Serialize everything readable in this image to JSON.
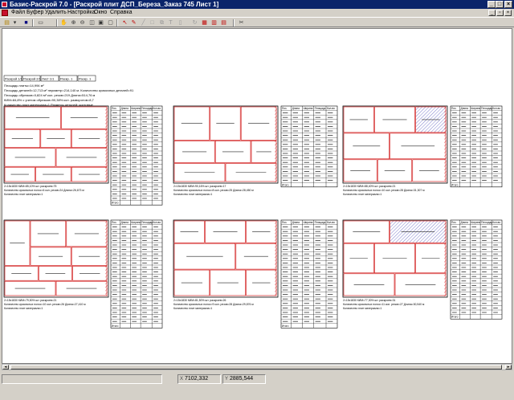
{
  "window": {
    "title": "Базис-Раскрой 7.0 - [Раскрой плит ДСП_Береза_Заказ 745 Лист 1]",
    "minimize": "_",
    "maximize": "□",
    "close": "×"
  },
  "menu": {
    "items": [
      "Файл",
      "Буфер",
      "Удалить",
      "Настройка",
      "Окно",
      "Справка"
    ],
    "mdi_minimize": "_",
    "mdi_restore": "▫",
    "mdi_close": "×"
  },
  "toolbar": {
    "icons": [
      "new-icon",
      "open-icon",
      "save-icon",
      "print-icon",
      "hand-icon",
      "zoom-in-icon",
      "zoom-out-icon",
      "zoom-window-icon",
      "zoom-fit-icon",
      "zoom-page-icon",
      "pointer-icon",
      "pen-icon",
      "line-icon",
      "rect-icon",
      "copy-icon",
      "text-icon",
      "erase-icon",
      "rotate-icon",
      "grid-icon",
      "cut-icon"
    ]
  },
  "header_block": {
    "tabs": [
      "Раскрой 1/1",
      "Раскрой 2/1",
      "Лист 1/1",
      "Раскр. 1",
      "Раскр. 1"
    ],
    "lines": [
      "Площадь плиты=14,994 м²",
      "Площадь деталей=12,713 м²  периметр=214,140 м. Количество кромочных деталей=91",
      "Площадь обрезков=0,824 м²  кол. резов=219  Длина=514,76 м",
      "КИМ=84,8%  с учетом обрезков=90,38%  кол. разворотов=8,7",
      "Количество плит материала=1          Размеры деталей: чистовые"
    ]
  },
  "cards": [
    {
      "footer": [
        "2=15x1830 КИМ=85,10%   шт. раскроев=75",
        "Количество кромочных полос=6  кол. резов=24  Длина=26,673 м",
        "Количество плит материала=1"
      ]
    },
    {
      "footer": [
        "2=15x1830 КИМ=90,16%   шт. раскроев=17",
        "Количество кромочных полос=8  кол. резов=25  Длина=28,450 м",
        "Количество плит материала=1"
      ]
    },
    {
      "footer": [
        "2=15x1830 КИМ=88,40%   шт. раскроев=21",
        "Количество кромочных полос=10  кол. резов=28  Длина=31,307 м",
        "Количество плит материала=1"
      ]
    },
    {
      "footer": [
        "2=15x1830 КИМ=79,50%   шт. раскроев=21",
        "Количество кромочных полос=10  кол. резов=26  Длина=27,410 м",
        "Количество плит материала=1"
      ]
    },
    {
      "footer": [
        "2=15x1830 КИМ=81,50%   шт. раскроев=26",
        "Количество кромочных полос=9  кол. резов=28  Длина=29,876 м",
        "Количество плит материала=1"
      ]
    },
    {
      "footer": [
        "2=15x1830 КИМ=77,30%   шт. раскроев=31",
        "Количество кромочных полос=11  кол. резов=27  Длина=30,540 м",
        "Количество плит материала=1"
      ]
    }
  ],
  "table": {
    "headers": [
      "Поз.",
      "Длина",
      "Ширина",
      "Площадь",
      "Кол-во"
    ],
    "footer_label": "Итого"
  },
  "status": {
    "field1": "",
    "x_label": "X",
    "x_value": "7102,332",
    "y_label": "Y",
    "y_value": "2885,544"
  },
  "colors": {
    "titlebar": "#0a246a",
    "accent": "#c8102e",
    "part_border": "#cc0000",
    "part_fill": "#ffffff",
    "hatch": "#6060c0"
  }
}
